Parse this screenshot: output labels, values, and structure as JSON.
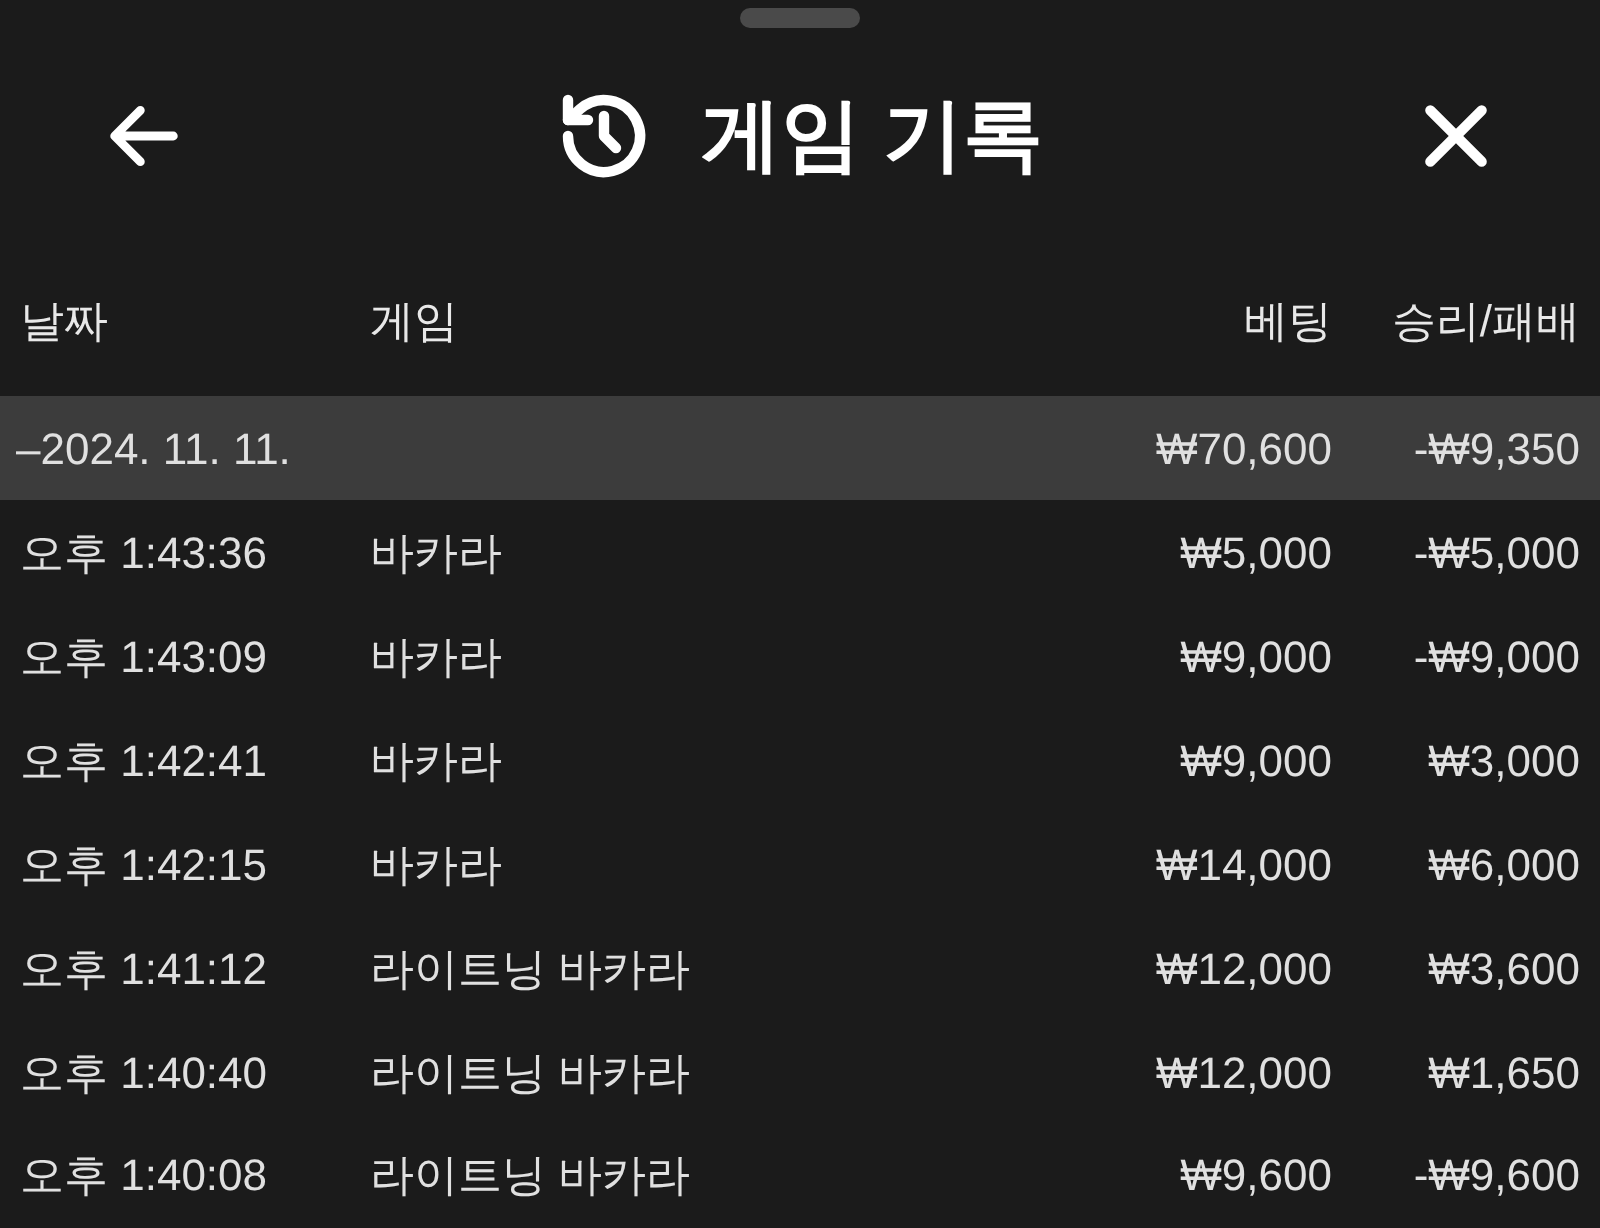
{
  "header": {
    "title": "게임 기록"
  },
  "table": {
    "columns": [
      "날짜",
      "게임",
      "베팅",
      "승리/패배"
    ],
    "group": {
      "date": "–2024. 11. 11.",
      "bet": "₩70,600",
      "result": "-₩9,350"
    },
    "rows": [
      {
        "time": "오후 1:43:36",
        "game": "바카라",
        "bet": "₩5,000",
        "result": "-₩5,000"
      },
      {
        "time": "오후 1:43:09",
        "game": "바카라",
        "bet": "₩9,000",
        "result": "-₩9,000"
      },
      {
        "time": "오후 1:42:41",
        "game": "바카라",
        "bet": "₩9,000",
        "result": "₩3,000"
      },
      {
        "time": "오후 1:42:15",
        "game": "바카라",
        "bet": "₩14,000",
        "result": "₩6,000"
      },
      {
        "time": "오후 1:41:12",
        "game": "라이트닝 바카라",
        "bet": "₩12,000",
        "result": "₩3,600"
      },
      {
        "time": "오후 1:40:40",
        "game": "라이트닝 바카라",
        "bet": "₩12,000",
        "result": "₩1,650"
      },
      {
        "time": "오후 1:40:08",
        "game": "라이트닝 바카라",
        "bet": "₩9,600",
        "result": "-₩9,600"
      }
    ]
  }
}
